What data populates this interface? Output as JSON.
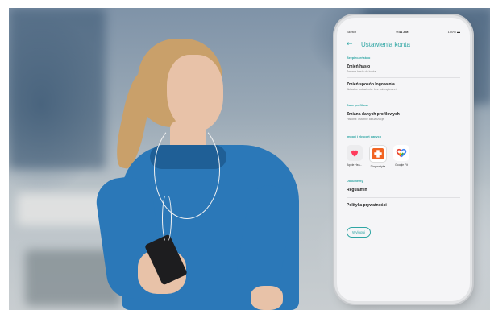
{
  "status_bar": {
    "carrier": "Sketch",
    "time": "9:41 AM",
    "battery": "100%"
  },
  "screen": {
    "title": "Ustawienia konta",
    "back_icon": "chevron-left-icon",
    "accent_color": "#2fa6a4"
  },
  "sections": {
    "security": {
      "label": "Bezpieczeństwo",
      "change_password": {
        "title": "Zmień hasło",
        "subtitle": "Zmiana hasła do konta"
      },
      "change_login": {
        "title": "Zmień sposób logowania",
        "subtitle": "Aktualne ustawienie: bez zabezpieczeń"
      }
    },
    "profile": {
      "label": "Dane profilowe",
      "change_data": {
        "title": "Zmiana danych profilowych",
        "subtitle": "Historia: ostatnie aktualizacje"
      }
    },
    "import_export": {
      "label": "Import i eksport danych",
      "apps": [
        {
          "label": "Apple Hea...",
          "icon": "heart-icon"
        },
        {
          "label": "Diagnostyka",
          "icon": "medical-cross-icon"
        },
        {
          "label": "Google Fit",
          "icon": "google-fit-heart-icon"
        }
      ]
    },
    "documents": {
      "label": "Dokumenty",
      "terms": "Regulamin",
      "privacy": "Polityka prywatności"
    }
  },
  "logout_label": "Wyloguj"
}
